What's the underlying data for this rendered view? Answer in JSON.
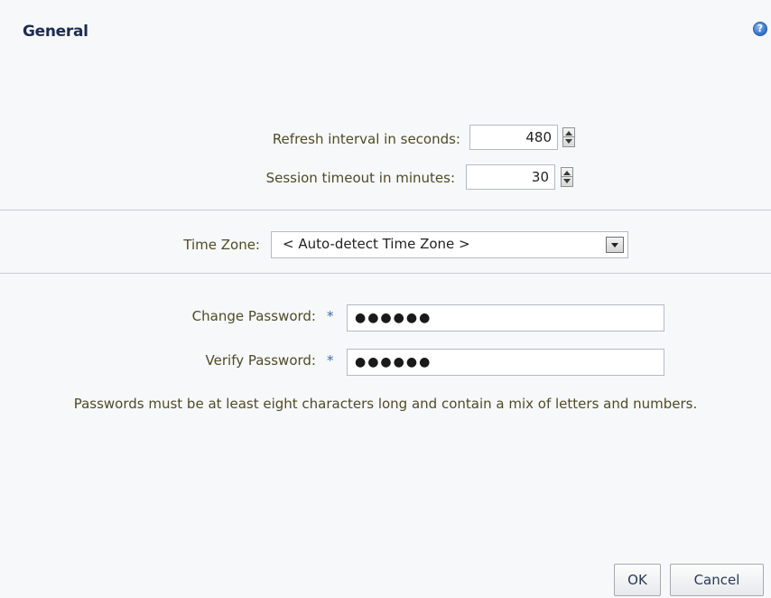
{
  "dialog": {
    "title": "General",
    "help_icon": "help-icon",
    "help_glyph": "?"
  },
  "refresh": {
    "label": "Refresh interval in seconds:",
    "value": "480"
  },
  "session": {
    "label": "Session timeout in minutes:",
    "value": "30"
  },
  "timezone": {
    "label": "Time Zone:",
    "selected": "< Auto-detect Time Zone >"
  },
  "change_password": {
    "label": "Change Password:",
    "required_marker": "*",
    "masked_value": "●●●●●●"
  },
  "verify_password": {
    "label": "Verify Password:",
    "required_marker": "*",
    "masked_value": "●●●●●●"
  },
  "note": "Passwords must be at least eight characters long and contain a mix of letters and numbers.",
  "buttons": {
    "ok": "OK",
    "cancel": "Cancel"
  },
  "colors": {
    "title": "#1c2c4f",
    "label": "#4e4b26",
    "required": "#3a6ea5",
    "background": "#f7f8fa"
  }
}
